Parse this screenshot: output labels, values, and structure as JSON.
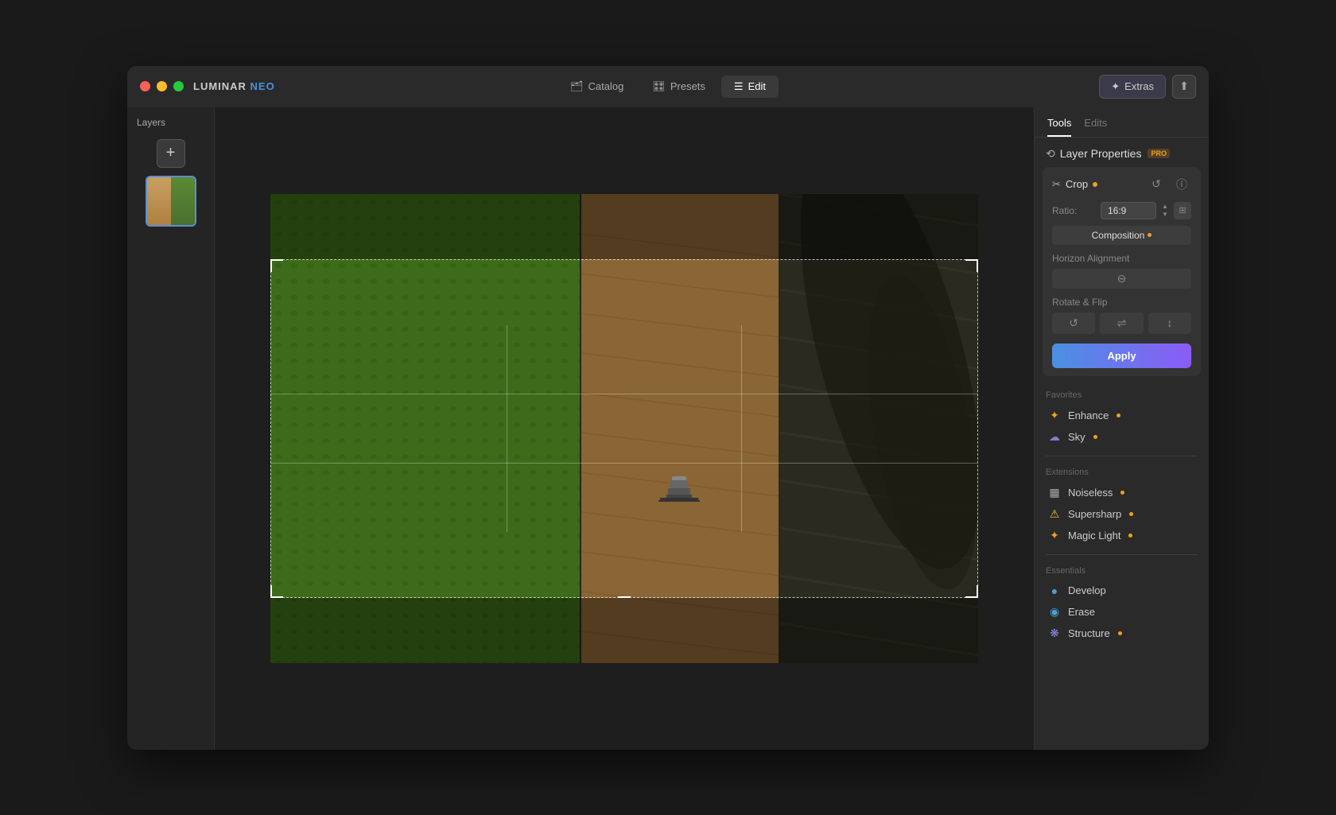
{
  "app": {
    "name": "LUMINAR",
    "name_accent": "NEO",
    "window_controls": [
      "close",
      "minimize",
      "maximize"
    ]
  },
  "title_bar": {
    "nav_items": [
      {
        "id": "catalog",
        "label": "Catalog",
        "icon": "🗂"
      },
      {
        "id": "presets",
        "label": "Presets",
        "icon": "🎛"
      },
      {
        "id": "edit",
        "label": "Edit",
        "icon": "☰",
        "active": true
      }
    ],
    "extras_label": "Extras",
    "share_icon": "⬆"
  },
  "layers_panel": {
    "title": "Layers",
    "add_button_label": "+"
  },
  "right_panel": {
    "tabs": [
      {
        "id": "tools",
        "label": "Tools",
        "active": true
      },
      {
        "id": "edits",
        "label": "Edits",
        "active": false
      }
    ],
    "layer_properties": {
      "title": "Layer Properties",
      "badge": "PRO"
    },
    "crop": {
      "title": "Crop",
      "ai_indicator": true,
      "ratio_label": "Ratio:",
      "ratio_value": "16:9",
      "composition_label": "Composition",
      "horizon_label": "Horizon Alignment",
      "rotate_flip_label": "Rotate & Flip",
      "apply_label": "Apply"
    },
    "favorites": {
      "title": "Favorites",
      "items": [
        {
          "id": "enhance",
          "label": "Enhance",
          "icon": "✦",
          "has_ai": true
        },
        {
          "id": "sky",
          "label": "Sky",
          "icon": "☁",
          "has_ai": true
        }
      ]
    },
    "extensions": {
      "title": "Extensions",
      "items": [
        {
          "id": "noiseless",
          "label": "Noiseless",
          "icon": "🔲",
          "has_ai": true
        },
        {
          "id": "supersharp",
          "label": "Supersharp",
          "icon": "⚠",
          "has_ai": true
        },
        {
          "id": "magic_light",
          "label": "Magic Light",
          "icon": "✦",
          "has_ai": true
        }
      ]
    },
    "essentials": {
      "title": "Essentials",
      "items": [
        {
          "id": "develop",
          "label": "Develop",
          "icon": "🔵"
        },
        {
          "id": "erase",
          "label": "Erase",
          "icon": "🔵"
        },
        {
          "id": "structure",
          "label": "Structure",
          "icon": "❋",
          "has_ai": true
        }
      ]
    }
  }
}
